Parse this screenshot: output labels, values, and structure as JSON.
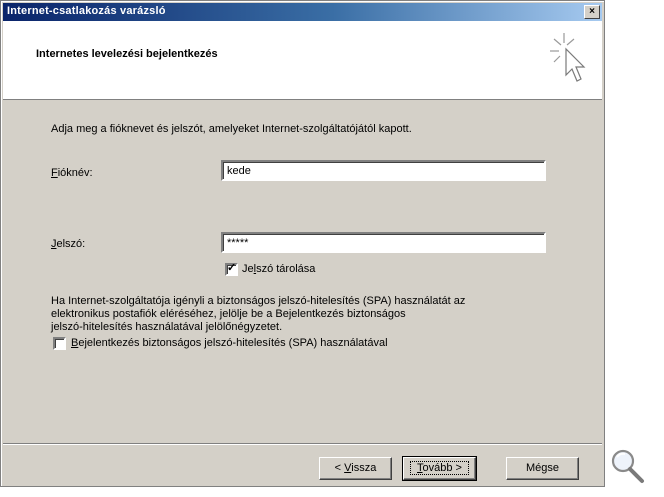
{
  "window": {
    "title": "Internet-csatlakozás varázsló",
    "close_glyph": "×"
  },
  "header": {
    "title": "Internetes levelezési bejelentkezés",
    "icon": "wizard-sparkle-cursor-icon"
  },
  "content": {
    "instruction": "Adja meg a fióknevet és jelszót, amelyeket Internet-szolgáltatójától kapott.",
    "account_label_accel": "F",
    "account_label_rest": "ióknév:",
    "account_value": "kede",
    "password_label_accel": "J",
    "password_label_rest": "elszó:",
    "password_value": "*****",
    "remember_checked": true,
    "remember_label_pre": "Je",
    "remember_label_accel": "l",
    "remember_label_post": "szó tárolása",
    "spa_info_line1": "Ha Internet-szolgáltatója igényli a biztonságos jelszó-hitelesítés (SPA) használatát az",
    "spa_info_line2": "elektronikus postafiók eléréséhez, jelölje be a Bejelentkezés biztonságos",
    "spa_info_line3": "jelszó-hitelesítés használatával jelölőnégyzetet.",
    "spa_checked": false,
    "spa_label_accel": "B",
    "spa_label_rest": "ejelentkezés biztonságos jelszó-hitelesítés (SPA) használatával"
  },
  "buttons": {
    "back_pre": "< ",
    "back_accel": "V",
    "back_rest": "issza",
    "next_accel": "T",
    "next_rest": "ovább >",
    "cancel": "Mégse"
  },
  "colors": {
    "titlebar_start": "#0a246a",
    "titlebar_end": "#a6caf0",
    "dialog_face": "#d4d0c8"
  },
  "overlay_icon": "magnifier-icon"
}
